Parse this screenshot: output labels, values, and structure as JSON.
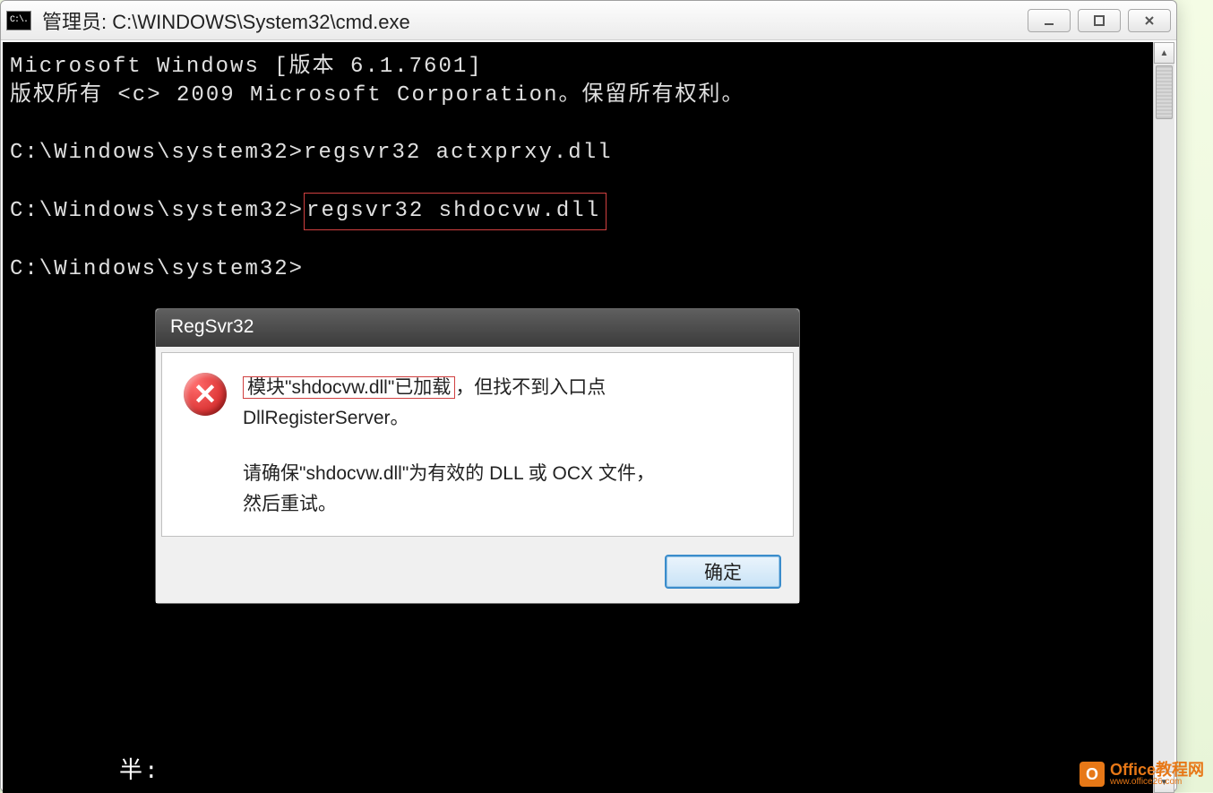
{
  "window": {
    "icon_text": "C:\\.",
    "title": "管理员: C:\\WINDOWS\\System32\\cmd.exe"
  },
  "terminal": {
    "line1": "Microsoft Windows [版本 6.1.7601]",
    "line2": "版权所有 <c> 2009 Microsoft Corporation。保留所有权利。",
    "line3_prompt": "C:\\Windows\\system32>",
    "line3_cmd": "regsvr32 actxprxy.dll",
    "line4_prompt": "C:\\Windows\\system32>",
    "line4_cmd": "regsvr32 shdocvw.dll",
    "line5_prompt": "C:\\Windows\\system32>",
    "ime": "半:"
  },
  "dialog": {
    "title": "RegSvr32",
    "msg_boxed": "模块\"shdocvw.dll\"已加载",
    "msg_rest1": "，但找不到入口点",
    "msg_line2": "DllRegisterServer。",
    "msg_p2a": "请确保\"shdocvw.dll\"为有效的 DLL 或 OCX 文件，",
    "msg_p2b": "然后重试。",
    "ok": "确定"
  },
  "watermark": {
    "icon": "O",
    "main": "Office教程网",
    "sub": "www.office26.com"
  }
}
